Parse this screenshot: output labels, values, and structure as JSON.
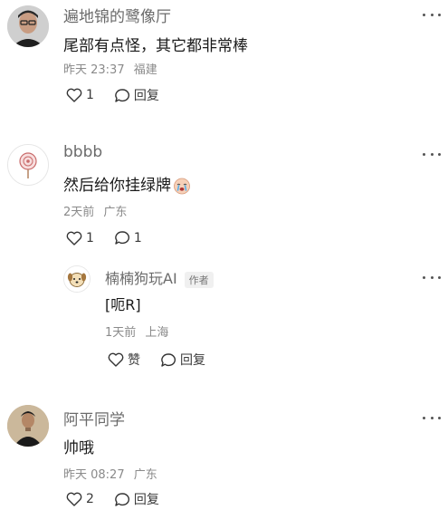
{
  "comments": [
    {
      "name": "遍地锦的鹭像厅",
      "text": "尾部有点怪，其它都非常棒",
      "time": "昨天 23:37",
      "location": "福建",
      "like_count": "1",
      "reply_label": "回复",
      "avatar_icon": "man-portrait-avatar"
    },
    {
      "name": "bbbb",
      "text": "然后给你挂绿牌",
      "emoji": "crying-face-emoji",
      "time": "2天前",
      "location": "广东",
      "like_count": "1",
      "reply_count": "1",
      "avatar_icon": "lollipop-avatar"
    },
    {
      "name": "阿平同学",
      "text": "帅哦",
      "time": "昨天 08:27",
      "location": "广东",
      "like_count": "2",
      "reply_label": "回复",
      "avatar_icon": "man-dark-portrait-avatar"
    }
  ],
  "reply": {
    "name": "楠楠狗玩AI",
    "badge": "作者",
    "text": "[呃R]",
    "time": "1天前",
    "location": "上海",
    "like_label": "赞",
    "reply_label": "回复",
    "avatar_icon": "dog-avatar"
  },
  "colors": {
    "name": "#6b6b6b",
    "meta": "#8a8a8a",
    "text": "#1a1a1a"
  }
}
